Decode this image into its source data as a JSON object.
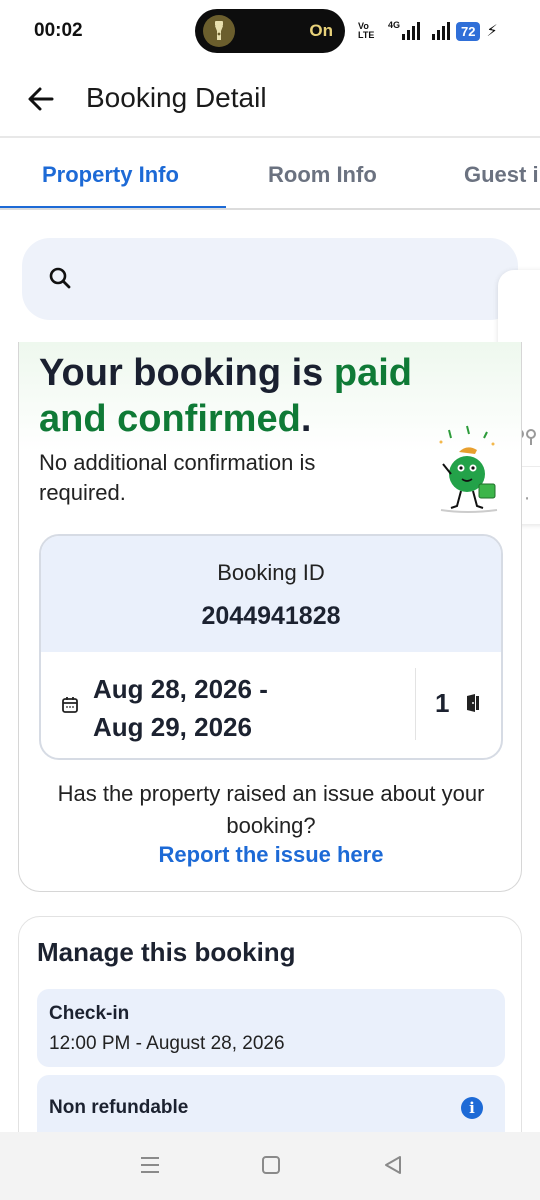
{
  "status_bar": {
    "time": "00:02",
    "pill_text": "On",
    "volte_line1": "Vo",
    "volte_line2": "LTE",
    "network": "4G",
    "battery": "72",
    "icons": [
      "flashlight-icon",
      "volte-icon",
      "signal-icon",
      "signal-icon",
      "battery-icon",
      "charging-bolt-icon"
    ]
  },
  "header": {
    "title": "Booking Detail",
    "back_icon": "back-arrow-icon"
  },
  "tabs": [
    {
      "label": "Property Info",
      "active": true
    },
    {
      "label": "Room Info",
      "active": false
    },
    {
      "label": "Guest i",
      "active": false
    }
  ],
  "search": {
    "icon": "search-icon",
    "placeholder": ""
  },
  "confirmation": {
    "headline_part1": "Your booking is ",
    "headline_green1": "paid",
    "headline_green2": "and confirmed",
    "headline_end": ".",
    "subtext": "No additional confirmation is required.",
    "booking_id_label": "Booking ID",
    "booking_id": "2044941828",
    "date_from": "Aug 28, 2026 -",
    "date_to": "Aug 29, 2026",
    "room_count": "1",
    "issue_text": "Has the property raised an issue about your booking?",
    "report_link": "Report the issue here",
    "accent_green": "#0f7a36"
  },
  "manage": {
    "title": "Manage this booking",
    "checkin_label": "Check-in",
    "checkin_value": "12:00 PM - August 28, 2026",
    "refund_label": "Non refundable"
  },
  "nav_bar": {
    "icons": [
      "menu-icon",
      "home-icon",
      "back-icon"
    ]
  },
  "colors": {
    "link_blue": "#1d6ad6",
    "card_tint": "#eaf0fb"
  }
}
